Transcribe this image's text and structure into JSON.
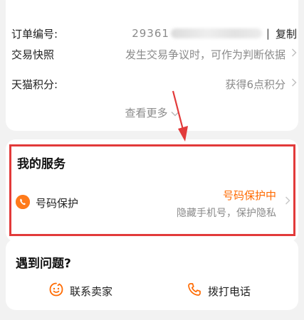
{
  "order_info": {
    "order_number_label": "订单编号:",
    "order_number_visible": "29361",
    "copy_label": "复制",
    "separator": "|",
    "snapshot_label": "交易快照",
    "snapshot_value": "发生交易争议时，可作为判断依据",
    "points_label": "天猫积分:",
    "points_value": "获得6点积分",
    "view_more": "查看更多"
  },
  "services": {
    "title": "我的服务",
    "item_label": "号码保护",
    "item_status": "号码保护中",
    "item_desc": "隐藏手机号，保护隐私"
  },
  "help": {
    "title": "遇到问题?",
    "contact_seller": "联系卖家",
    "call_phone": "拨打电话"
  },
  "colors": {
    "accent_orange": "#ff6a00",
    "highlight_red": "#e23a3a",
    "background": "#f2f2f2"
  },
  "icons": [
    "chevron-right-icon",
    "chevron-down-icon",
    "phone-shield-icon",
    "smile-face-icon",
    "phone-handset-icon"
  ]
}
